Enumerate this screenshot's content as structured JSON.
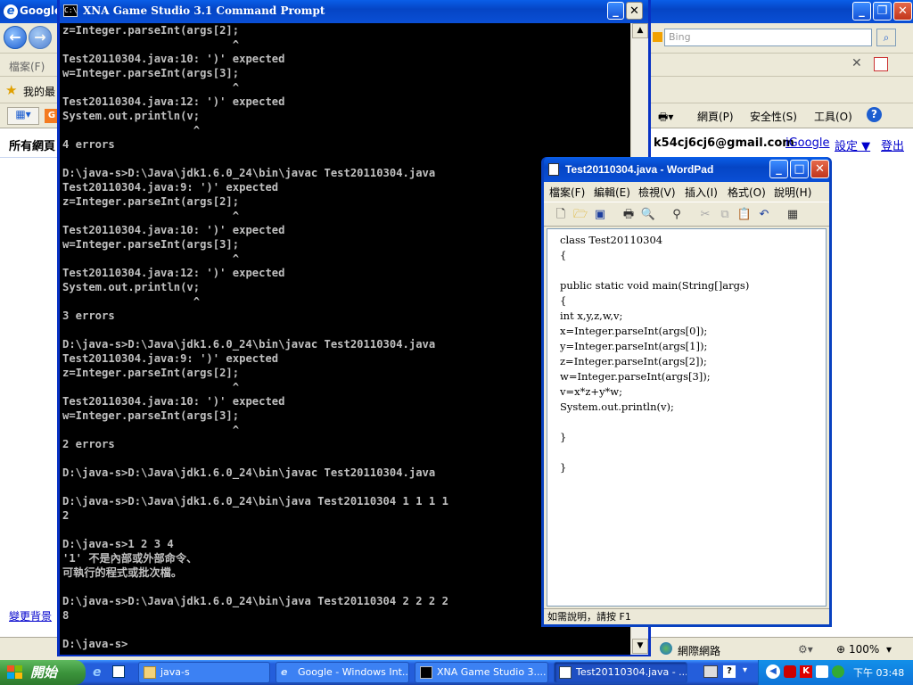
{
  "ie": {
    "title": "Google",
    "search_placeholder": "Bing",
    "menu_first": "檔案(F)",
    "favorites_label": "我的最",
    "cmd_page": "網頁(P)",
    "cmd_safety": "安全性(S)",
    "cmd_tools": "工具(O)",
    "sidebar_label": "所有網頁",
    "account_email": "k54cj6cj6@gmail.com",
    "link_igoogle": "iGoogle",
    "link_settings": "設定 ▼",
    "link_logout": "登出",
    "change_bg": "變更背景",
    "status_zone": "網際網路",
    "status_zoom": "100%"
  },
  "console": {
    "title": "XNA Game Studio 3.1 Command Prompt",
    "text": "z=Integer.parseInt(args[2];\n                          ^\nTest20110304.java:10: ')' expected\nw=Integer.parseInt(args[3];\n                          ^\nTest20110304.java:12: ')' expected\nSystem.out.println(v;\n                    ^\n4 errors\n\nD:\\java-s>D:\\Java\\jdk1.6.0_24\\bin\\javac Test20110304.java\nTest20110304.java:9: ')' expected\nz=Integer.parseInt(args[2];\n                          ^\nTest20110304.java:10: ')' expected\nw=Integer.parseInt(args[3];\n                          ^\nTest20110304.java:12: ')' expected\nSystem.out.println(v;\n                    ^\n3 errors\n\nD:\\java-s>D:\\Java\\jdk1.6.0_24\\bin\\javac Test20110304.java\nTest20110304.java:9: ')' expected\nz=Integer.parseInt(args[2];\n                          ^\nTest20110304.java:10: ')' expected\nw=Integer.parseInt(args[3];\n                          ^\n2 errors\n\nD:\\java-s>D:\\Java\\jdk1.6.0_24\\bin\\javac Test20110304.java\n\nD:\\java-s>D:\\Java\\jdk1.6.0_24\\bin\\java Test20110304 1 1 1 1\n2\n\nD:\\java-s>1 2 3 4\n'1' 不是內部或外部命令、\n可執行的程式或批次檔。\n\nD:\\java-s>D:\\Java\\jdk1.6.0_24\\bin\\java Test20110304 2 2 2 2\n8\n\nD:\\java-s>"
  },
  "wordpad": {
    "title": "Test20110304.java - WordPad",
    "menu": [
      "檔案(F)",
      "編輯(E)",
      "檢視(V)",
      "插入(I)",
      "格式(O)",
      "說明(H)"
    ],
    "document": "class Test20110304\n{\n\npublic static void main(String[]args)\n{\nint x,y,z,w,v;\nx=Integer.parseInt(args[0]);\ny=Integer.parseInt(args[1]);\nz=Integer.parseInt(args[2]);\nw=Integer.parseInt(args[3]);\nv=x*z+y*w;\nSystem.out.println(v);\n\n}\n\n}",
    "status": "如需說明，請按 F1"
  },
  "taskbar": {
    "start_label": "開始",
    "tasks": [
      "java-s",
      "Google - Windows Int...",
      "XNA Game Studio 3....",
      "Test20110304.java - ..."
    ],
    "clock": "下午 03:48"
  },
  "colors": {
    "xp_blue": "#0a4fd5",
    "console_bg": "#000000",
    "console_fg": "#c0c0c0",
    "taskbar": "#245edb"
  }
}
